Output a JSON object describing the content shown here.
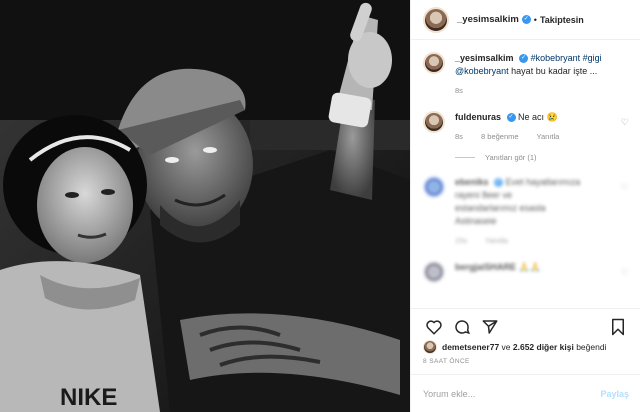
{
  "post": {
    "username": "_yesimsalkim",
    "follow_separator": "•",
    "follow_state": "Takiptesin"
  },
  "caption": {
    "username": "_yesimsalkim",
    "hashtag1": "#kobebryant",
    "hashtag2": "#gigi",
    "mention": "@kobebryant",
    "text": " hayat bu kadar işte ...",
    "time": "8s"
  },
  "comments": [
    {
      "username": "fuldenuras",
      "text": "Ne acı",
      "emoji": "😢",
      "time": "8s",
      "likes": "8 beğenme",
      "reply": "Yanıtla",
      "view_replies": "Yanıtları gör (1)"
    },
    {
      "username": "ebeniks",
      "line1": "Evet hayatlarımıza",
      "line2": "rayeni 8eer ve",
      "line3": "estandarlarımız esasla",
      "line4": "Astinaseie",
      "time": "15s",
      "reply": "Yanıtla"
    },
    {
      "username": "bergjaiSHARE",
      "emoji": "🙏🙏"
    }
  ],
  "likes": {
    "liker": "demetsener77",
    "connector": " ve ",
    "others": "2.652 diğer kişi",
    "suffix": " beğendi"
  },
  "timestamp": "8 SAAT ÖNCE",
  "add_comment": {
    "placeholder": "Yorum ekle...",
    "post_label": "Paylaş"
  },
  "photo": {
    "shirt_text": "NIKE"
  },
  "colors": {
    "link": "#00376b",
    "verified": "#3897f0",
    "muted": "#8e8e8e",
    "post_button": "#b2dffc"
  },
  "icons": [
    "verified-icon",
    "heart-icon",
    "comment-icon",
    "share-icon",
    "bookmark-icon"
  ]
}
